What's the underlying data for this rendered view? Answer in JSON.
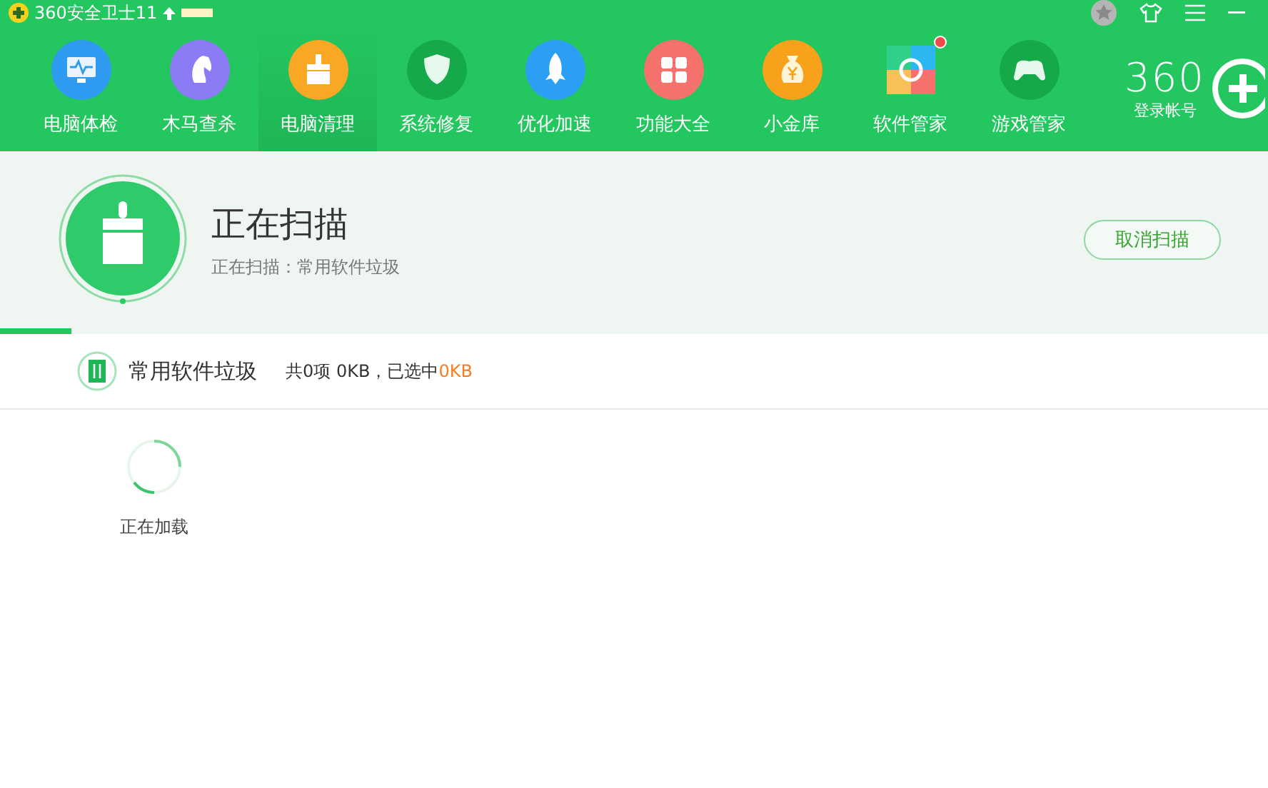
{
  "window": {
    "title": "360安全卫士11"
  },
  "nav": [
    {
      "label": "电脑体检",
      "selected": false,
      "notification": false
    },
    {
      "label": "木马查杀",
      "selected": false,
      "notification": false
    },
    {
      "label": "电脑清理",
      "selected": true,
      "notification": false
    },
    {
      "label": "系统修复",
      "selected": false,
      "notification": false
    },
    {
      "label": "优化加速",
      "selected": false,
      "notification": false
    },
    {
      "label": "功能大全",
      "selected": false,
      "notification": false
    },
    {
      "label": "小金库",
      "selected": false,
      "notification": false
    },
    {
      "label": "软件管家",
      "selected": false,
      "notification": true
    },
    {
      "label": "游戏管家",
      "selected": false,
      "notification": false
    }
  ],
  "account": {
    "logo": "360",
    "label": "登录帐号"
  },
  "scan": {
    "title": "正在扫描",
    "subtitle": "正在扫描：常用软件垃圾",
    "cancel_button": "取消扫描",
    "level": 0.056
  },
  "category": {
    "name": "常用软件垃圾",
    "summary": "共0项 0KB，已选中",
    "selected_size": "0KB"
  },
  "loading": {
    "label": "正在加载"
  }
}
